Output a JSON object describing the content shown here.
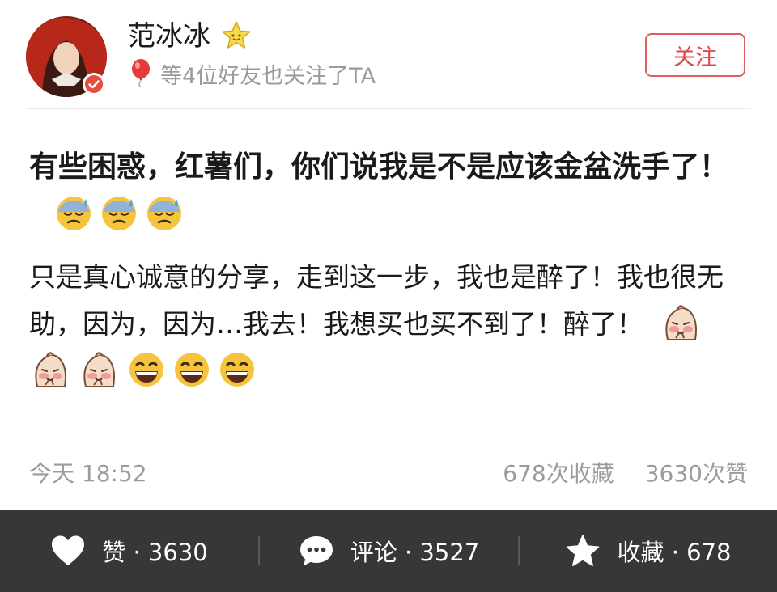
{
  "user": {
    "name": "范冰冰",
    "follow_hint": "等4位好友也关注了TA",
    "follow_label": "关注"
  },
  "post": {
    "title_text": "有些困惑，红薯们，你们说我是不是应该金盆洗手了！",
    "body_text": "只是真心诚意的分享，走到这一步，我也是醉了！我也很无助，因为，因为…我去！我想买也买不到了！醉了！",
    "time": "今天 18:52",
    "favorites_count": "678次收藏",
    "likes_count": "3630次赞"
  },
  "actions": {
    "like": "赞 · 3630",
    "comment": "评论 · 3527",
    "favorite": "收藏 · 678"
  },
  "icons": {
    "title_emojis": [
      "sweat-face-icon",
      "sweat-face-icon",
      "sweat-face-icon"
    ],
    "body_emojis": [
      "shy-potato-icon",
      "shy-potato-icon",
      "shy-potato-icon",
      "grin-icon",
      "grin-icon",
      "grin-icon"
    ]
  },
  "colors": {
    "accent_red": "#e0494a",
    "action_bar_bg": "#373737",
    "muted_text": "#9b9b9b"
  }
}
